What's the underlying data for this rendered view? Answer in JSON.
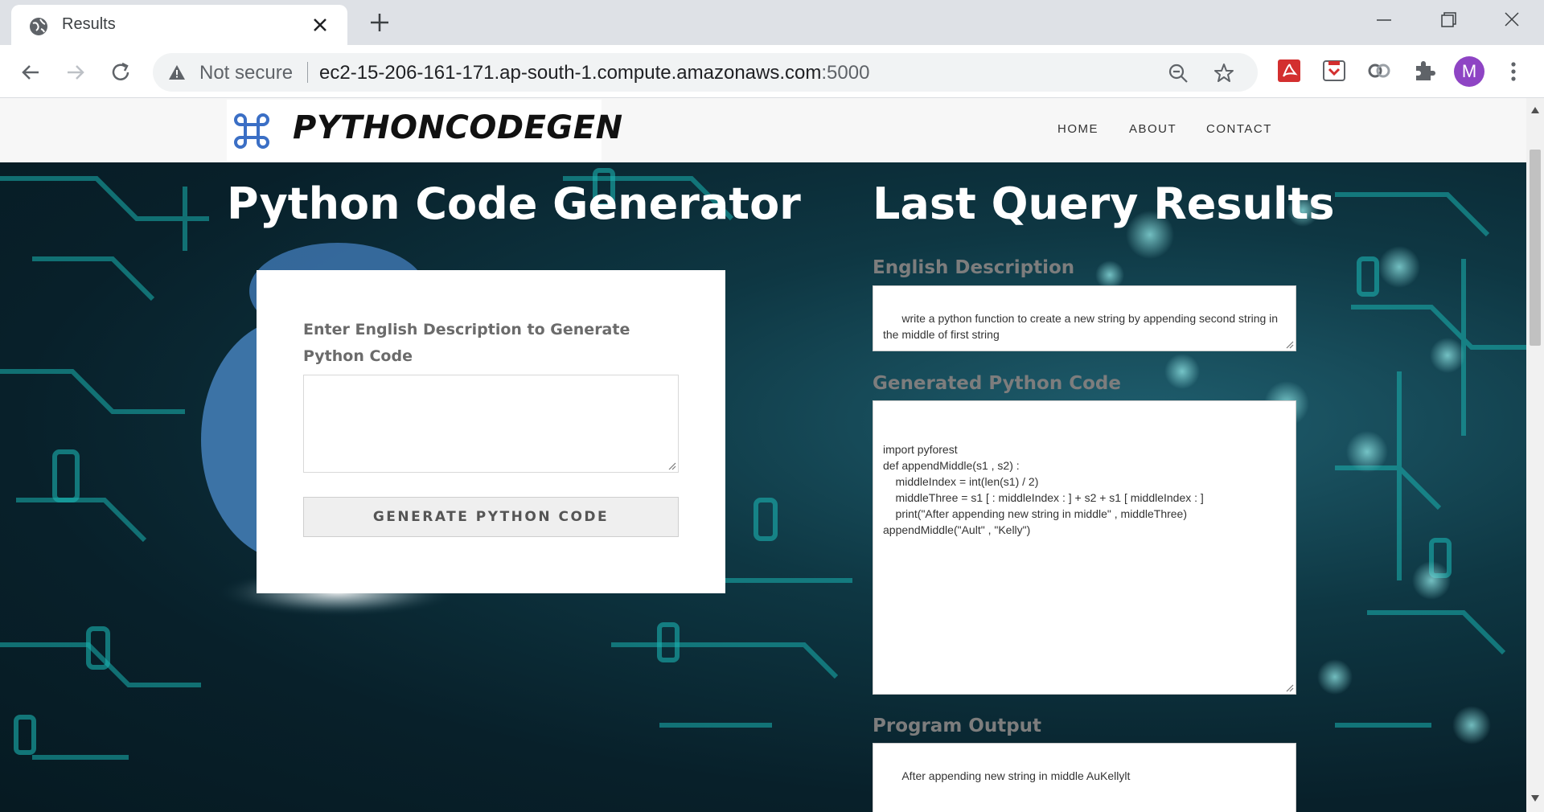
{
  "browser": {
    "tab_title": "Results",
    "security_label": "Not secure",
    "url_host": "ec2-15-206-161-171.ap-south-1.compute.amazonaws.com",
    "url_port": ":5000",
    "profile_initial": "M"
  },
  "site": {
    "logo_text": "PYTHONCODEGEN",
    "nav": [
      "HOME",
      "ABOUT",
      "CONTACT"
    ]
  },
  "generator": {
    "title": "Python Code Generator",
    "input_label": "Enter English Description to Generate Python Code",
    "input_value": "",
    "button_label": "GENERATE PYTHON CODE"
  },
  "results": {
    "title": "Last Query Results",
    "description_label": "English Description",
    "description_value": "write a python function to create a new string by appending second string in the middle of first string",
    "code_label": "Generated Python Code",
    "code_value": "import pyforest\ndef appendMiddle(s1 , s2) :\n    middleIndex = int(len(s1) / 2)\n    middleThree = s1 [ : middleIndex : ] + s2 + s1 [ middleIndex : ]\n    print(\"After appending new string in middle\" , middleThree)\nappendMiddle(\"Ault\" , \"Kelly\")",
    "output_label": "Program Output",
    "output_value": "After appending new string in middle AuKellylt"
  },
  "colors": {
    "hero_bg": "#0e3743",
    "circuit": "#1ab3b0",
    "card_bg": "#ffffff",
    "label_gray": "#7d7d7d"
  }
}
